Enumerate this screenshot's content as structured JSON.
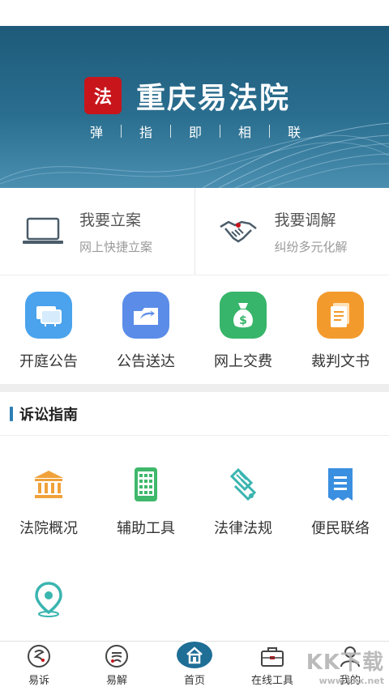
{
  "banner": {
    "logo_char": "法",
    "app_title": "重庆易法院",
    "slogan": [
      "弹",
      "指",
      "即",
      "相",
      "联"
    ]
  },
  "quick_actions": [
    {
      "title": "我要立案",
      "subtitle": "网上快捷立案",
      "icon": "laptop-icon"
    },
    {
      "title": "我要调解",
      "subtitle": "纠纷多元化解",
      "icon": "handshake-icon"
    }
  ],
  "services": [
    {
      "label": "开庭公告",
      "icon": "courtroom-icon",
      "color": "#4aa3ec"
    },
    {
      "label": "公告送达",
      "icon": "folder-share-icon",
      "color": "#5b8ce8"
    },
    {
      "label": "网上交费",
      "icon": "money-bag-icon",
      "color": "#37b56a"
    },
    {
      "label": "裁判文书",
      "icon": "document-icon",
      "color": "#f39a2c"
    }
  ],
  "guide": {
    "title": "诉讼指南",
    "items": [
      {
        "label": "法院概况",
        "icon": "courthouse-icon",
        "color": "#f0a23a"
      },
      {
        "label": "辅助工具",
        "icon": "calculator-phone-icon",
        "color": "#3fb86b"
      },
      {
        "label": "法律法规",
        "icon": "scroll-icon",
        "color": "#3ab5b0"
      },
      {
        "label": "便民联络",
        "icon": "receipt-icon",
        "color": "#3a8fe0"
      }
    ],
    "extra_icon": "location-pin-icon"
  },
  "tabbar": [
    {
      "label": "易诉",
      "icon": "yisu-icon"
    },
    {
      "label": "易解",
      "icon": "yijie-icon"
    },
    {
      "label": "首页",
      "icon": "home-icon"
    },
    {
      "label": "在线工具",
      "icon": "briefcase-icon"
    },
    {
      "label": "我的",
      "icon": "user-icon"
    }
  ],
  "watermark": {
    "text": "KK下载",
    "sub": "www.kkx.net"
  }
}
